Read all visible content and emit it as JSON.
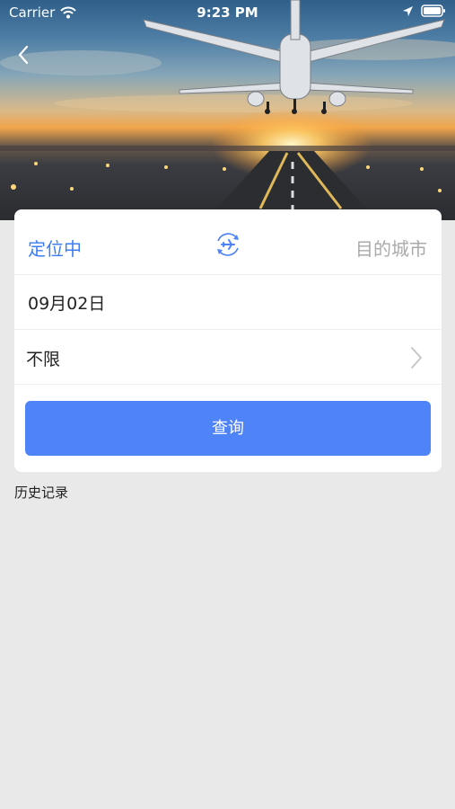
{
  "status_bar": {
    "carrier": "Carrier",
    "time": "9:23 PM"
  },
  "form": {
    "from_city": "定位中",
    "to_city": "目的城市",
    "date": "09月02日",
    "seat_class": "不限",
    "search_label": "查询"
  },
  "history": {
    "title": "历史记录"
  },
  "colors": {
    "accent": "#4f83f8",
    "from_city_text": "#3d7cf2",
    "placeholder_text": "#aaaaaa",
    "background": "#e9e9e9"
  },
  "icons": {
    "back": "chevron-left-icon",
    "swap": "airplane-swap-icon",
    "seat_chevron": "chevron-right-icon"
  }
}
